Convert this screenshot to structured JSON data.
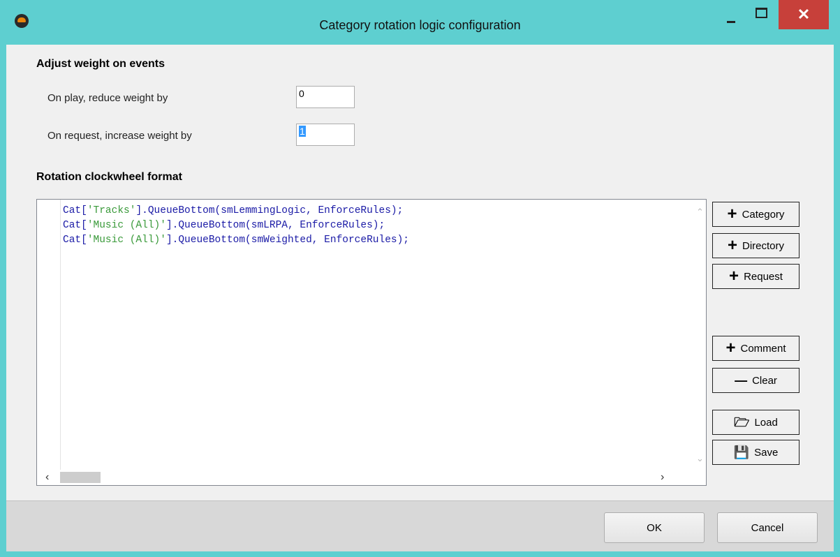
{
  "window": {
    "title": "Category rotation logic configuration",
    "close_glyph": "✕"
  },
  "events": {
    "heading": "Adjust weight on events",
    "play_label": "On play, reduce weight by",
    "play_value": "0",
    "request_label": "On request, increase weight by",
    "request_value": "1"
  },
  "rotation": {
    "heading": "Rotation clockwheel format",
    "lines": [
      {
        "pre": "Cat[",
        "str": "'Tracks'",
        "post": "].QueueBottom(smLemmingLogic, EnforceRules);"
      },
      {
        "pre": "Cat[",
        "str": "'Music (All)'",
        "post": "].QueueBottom(smLRPA, EnforceRules);"
      },
      {
        "pre": "Cat[",
        "str": "'Music (All)'",
        "post": "].QueueBottom(smWeighted, EnforceRules);"
      }
    ]
  },
  "side_buttons": {
    "category": "Category",
    "directory": "Directory",
    "request": "Request",
    "comment": "Comment",
    "clear": "Clear",
    "load": "Load",
    "save": "Save"
  },
  "icons": {
    "plus": "+",
    "minus": "—",
    "folder": "🗁",
    "disk": "💾"
  },
  "footer": {
    "ok": "OK",
    "cancel": "Cancel"
  }
}
